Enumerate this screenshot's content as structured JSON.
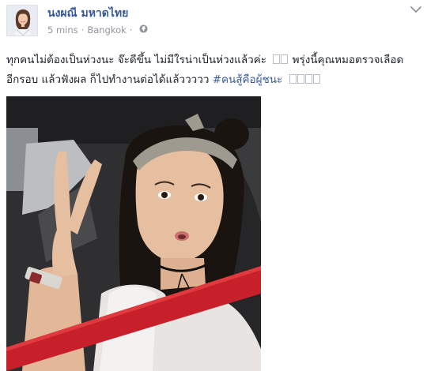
{
  "post": {
    "author_name": "นงผณี มหาดไทย",
    "timestamp": "5 mins",
    "location": "Bangkok",
    "separator": "·",
    "text": {
      "line1_before": "ทุกคนไม่ต้องเป็นห่วงนะ จ๊ะดีขึ้น ไม่มีใรน่าเป็นห่วงแล้วค่ะ",
      "line1_after": "พรุ่งนี้คุณหมอตรวจเลือด",
      "line2_before": "อีกรอบ แล้วฟังผล ก็ไปทำงานต่อได้แล้ววววว",
      "hashtag": "#คนสู้คือผู้ชนะ"
    }
  },
  "icons": {
    "globe": "globe-icon",
    "options": "chevron-down-icon"
  },
  "colors": {
    "author_link": "#365899",
    "meta_gray": "#90949c",
    "text": "#1d2129",
    "seatbelt": "#c8202a"
  }
}
